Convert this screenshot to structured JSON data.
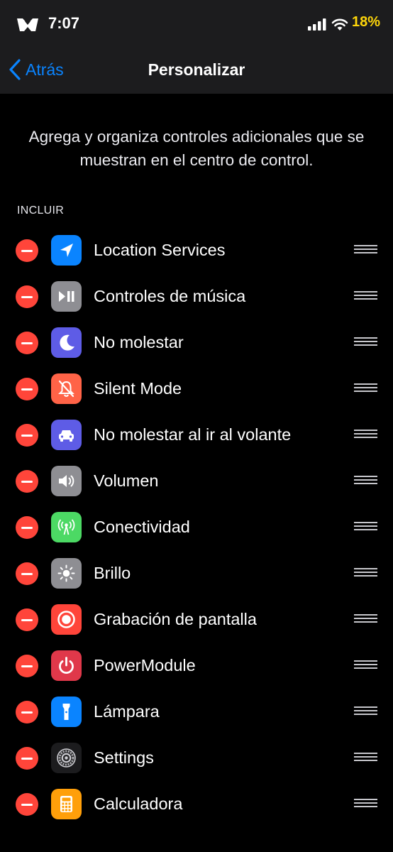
{
  "status_bar": {
    "time": "7:07",
    "battery_text": "18%",
    "battery_color": "#ffd60a",
    "icons": [
      "carrier-logo-icon",
      "signal-icon",
      "wifi-icon"
    ]
  },
  "nav": {
    "back_label": "Atrás",
    "title": "Personalizar"
  },
  "description": "Agrega y organiza controles adicionales que se muestran en el centro de control.",
  "section": {
    "title": "INCLUIR"
  },
  "controls": [
    {
      "label": "Location Services",
      "icon": "location-arrow-icon",
      "color": "#0a84ff"
    },
    {
      "label": "Controles de música",
      "icon": "play-pause-icon",
      "color": "#8e8e93"
    },
    {
      "label": "No molestar",
      "icon": "moon-icon",
      "color": "#5e5ce6"
    },
    {
      "label": "Silent Mode",
      "icon": "bell-slash-icon",
      "color": "#ff6347"
    },
    {
      "label": "No molestar al ir al volante",
      "icon": "car-icon",
      "color": "#5e5ce6"
    },
    {
      "label": "Volumen",
      "icon": "speaker-icon",
      "color": "#8e8e93"
    },
    {
      "label": "Conectividad",
      "icon": "antenna-icon",
      "color": "#4cd964"
    },
    {
      "label": "Brillo",
      "icon": "sun-icon",
      "color": "#8e8e93"
    },
    {
      "label": "Grabación de pantalla",
      "icon": "record-icon",
      "color": "#ff453a"
    },
    {
      "label": "PowerModule",
      "icon": "power-icon",
      "color": "#e0384a"
    },
    {
      "label": "Lámpara",
      "icon": "flashlight-icon",
      "color": "#0a84ff"
    },
    {
      "label": "Settings",
      "icon": "gear-icon",
      "color": "#8e8e93"
    },
    {
      "label": "Calculadora",
      "icon": "calculator-icon",
      "color": "#ff9f0a"
    }
  ]
}
